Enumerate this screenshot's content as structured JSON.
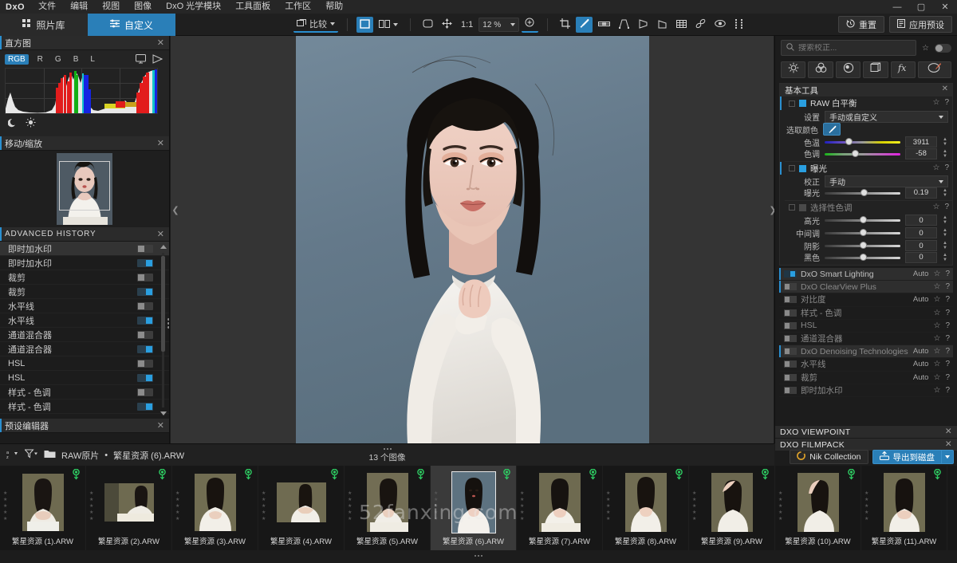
{
  "app": {
    "logo": "DxO"
  },
  "menubar": {
    "items": [
      "文件",
      "编辑",
      "视图",
      "图像",
      "DxO 光学模块",
      "工具面板",
      "工作区",
      "帮助"
    ],
    "window_controls": [
      "—",
      "▢",
      "✕"
    ]
  },
  "tabs": [
    {
      "label": "照片库",
      "icon": "grid-icon",
      "active": false
    },
    {
      "label": "自定义",
      "icon": "sliders-icon",
      "active": true
    }
  ],
  "toolbar": {
    "compare_label": "比较",
    "view_single_icon": "single-view-icon",
    "view_split_icon": "split-view-icon",
    "hand_icon": "hand-icon",
    "move_icon": "move-icon",
    "fit_label": "1:1",
    "zoom_value": "12 %",
    "zoom_in_icon": "zoom-in-icon",
    "tools": [
      "crop-icon",
      "eyedropper-icon",
      "horizon-icon",
      "perspective-icon",
      "keystone-icon",
      "parallel-icon",
      "grid-icon",
      "repair-icon",
      "redeye-icon",
      "mask-icon"
    ],
    "active_tool": "eyedropper-icon",
    "reset_label": "重置",
    "apply_preset_label": "应用预设"
  },
  "left_panel": {
    "histogram": {
      "title": "直方图",
      "channels": [
        "RGB",
        "R",
        "G",
        "B",
        "L"
      ],
      "active_channel": "RGB",
      "icons": [
        "monitor-icon",
        "gamut-icon"
      ],
      "footer_icons": [
        "moon-icon",
        "sun-icon"
      ]
    },
    "move_zoom": {
      "title": "移动/缩放"
    },
    "history": {
      "title": "ADVANCED HISTORY",
      "items": [
        {
          "label": "即时加水印",
          "on": false,
          "selected": true
        },
        {
          "label": "即时加水印",
          "on": true
        },
        {
          "label": "裁剪",
          "on": false
        },
        {
          "label": "裁剪",
          "on": true
        },
        {
          "label": "水平线",
          "on": false
        },
        {
          "label": "水平线",
          "on": true
        },
        {
          "label": "通道混合器",
          "on": false
        },
        {
          "label": "通道混合器",
          "on": true
        },
        {
          "label": "HSL",
          "on": false
        },
        {
          "label": "HSL",
          "on": true
        },
        {
          "label": "样式 - 色调",
          "on": false
        },
        {
          "label": "样式 - 色调",
          "on": true
        }
      ]
    },
    "preset_editor": {
      "title": "预设编辑器"
    }
  },
  "right_panel": {
    "search": {
      "placeholder": "搜索校正...",
      "value": ""
    },
    "category_icons": [
      "light-icon",
      "color-icon",
      "detail-icon",
      "geometry-icon",
      "fx-icon",
      "local-adjust-icon"
    ],
    "basic_tools": {
      "title": "基本工具",
      "white_balance": {
        "label": "RAW 白平衡",
        "enabled": true,
        "setting_label": "设置",
        "setting_value": "手动或自定义",
        "pick_color_label": "选取颜色",
        "temperature_label": "色温",
        "temperature_value": "3911",
        "tint_label": "色调",
        "tint_value": "-58"
      },
      "exposure": {
        "label": "曝光",
        "enabled": true,
        "correction_label": "校正",
        "correction_value": "手动",
        "exposure_label": "曝光",
        "exposure_value": "0.19"
      },
      "selective_tone": {
        "label": "选择性色调",
        "enabled": false,
        "rows": [
          {
            "label": "高光",
            "value": "0"
          },
          {
            "label": "中间调",
            "value": "0"
          },
          {
            "label": "阴影",
            "value": "0"
          },
          {
            "label": "黑色",
            "value": "0"
          }
        ]
      }
    },
    "tool_list": [
      {
        "label": "DxO Smart Lighting",
        "on": true,
        "auto": "Auto",
        "active": true,
        "dim": false
      },
      {
        "label": "DxO ClearView Plus",
        "on": false,
        "auto": "",
        "active": true,
        "dim": true
      },
      {
        "label": "对比度",
        "on": false,
        "auto": "Auto",
        "active": false,
        "dim": false
      },
      {
        "label": "样式 - 色调",
        "on": false,
        "auto": "",
        "active": false,
        "dim": false
      },
      {
        "label": "HSL",
        "on": false,
        "auto": "",
        "active": false,
        "dim": false
      },
      {
        "label": "通道混合器",
        "on": false,
        "auto": "",
        "active": false,
        "dim": false
      },
      {
        "label": "DxO Denoising Technologies",
        "on": false,
        "auto": "Auto",
        "active": true,
        "dim": true
      },
      {
        "label": "水平线",
        "on": false,
        "auto": "Auto",
        "active": false,
        "dim": false
      },
      {
        "label": "裁剪",
        "on": false,
        "auto": "Auto",
        "active": false,
        "dim": false
      },
      {
        "label": "即时加水印",
        "on": false,
        "auto": "",
        "active": false,
        "dim": false
      }
    ],
    "module_bars": [
      "DXO VIEWPOINT",
      "DXO FILMPACK"
    ],
    "footer": {
      "nik_label": "Nik Collection",
      "export_label": "导出到磁盘"
    }
  },
  "filmstrip_bar": {
    "sort_icon": "sort-az-icon",
    "filter_icon": "filter-icon",
    "folder_icon": "folder-icon",
    "folder_name": "RAW原片",
    "separator": "•",
    "file_name": "繁星资源 (6).ARW",
    "image_count": "13 个图像"
  },
  "filmstrip": {
    "items": [
      {
        "name": "繁星资源 (1).ARW",
        "selected": false,
        "orientation": "portrait"
      },
      {
        "name": "繁星资源 (2).ARW",
        "selected": false,
        "orientation": "landscape"
      },
      {
        "name": "繁星资源 (3).ARW",
        "selected": false,
        "orientation": "portrait"
      },
      {
        "name": "繁星资源 (4).ARW",
        "selected": false,
        "orientation": "landscape"
      },
      {
        "name": "繁星资源 (5).ARW",
        "selected": false,
        "orientation": "portrait"
      },
      {
        "name": "繁星资源 (6).ARW",
        "selected": true,
        "orientation": "portrait"
      },
      {
        "name": "繁星资源 (7).ARW",
        "selected": false,
        "orientation": "portrait"
      },
      {
        "name": "繁星资源 (8).ARW",
        "selected": false,
        "orientation": "portrait"
      },
      {
        "name": "繁星资源 (9).ARW",
        "selected": false,
        "orientation": "portrait"
      },
      {
        "name": "繁星资源 (10).ARW",
        "selected": false,
        "orientation": "portrait"
      },
      {
        "name": "繁星资源 (11).ARW",
        "selected": false,
        "orientation": "portrait"
      }
    ]
  },
  "watermark": {
    "text": "52fanxing.com"
  },
  "colors": {
    "accent": "#2a7fb8",
    "accent_light": "#2a9fe0",
    "panel_bg": "#1c1c1c",
    "canvas_bg": "#343434",
    "photo_bg": "#63788 6"
  }
}
